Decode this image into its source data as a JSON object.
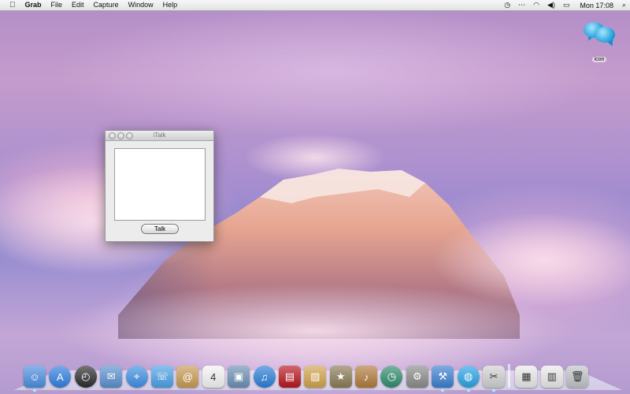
{
  "menubar": {
    "apple_icon": "apple-icon",
    "app_name": "Grab",
    "menus": [
      "File",
      "Edit",
      "Capture",
      "Window",
      "Help"
    ],
    "status_icons": [
      "time-machine-icon",
      "bluetooth-icon",
      "wifi-icon",
      "volume-icon",
      "battery-icon"
    ],
    "clock": "Mon 17:08",
    "spotlight_icon": "spotlight-icon"
  },
  "desktop": {
    "icon_label": "icon"
  },
  "window": {
    "title": "iTalk",
    "button_label": "Talk",
    "text_value": ""
  },
  "dock": {
    "items": [
      {
        "name": "finder-icon",
        "color": "#4a8ee0",
        "glyph": "☺",
        "running": true
      },
      {
        "name": "app-store-icon",
        "color": "#2f7fe0",
        "glyph": "A",
        "running": false
      },
      {
        "name": "dashboard-icon",
        "color": "#2b2b2b",
        "glyph": "◴",
        "running": false
      },
      {
        "name": "mail-stamp-icon",
        "color": "#5a8fcf",
        "glyph": "✉",
        "running": false
      },
      {
        "name": "safari-icon",
        "color": "#3d8fe4",
        "glyph": "⌖",
        "running": false
      },
      {
        "name": "facetime-icon",
        "color": "#4aa0e8",
        "glyph": "☏",
        "running": false
      },
      {
        "name": "address-book-icon",
        "color": "#c79a52",
        "glyph": "@",
        "running": false
      },
      {
        "name": "ical-icon",
        "color": "#f4f4f4",
        "glyph": "4",
        "running": false
      },
      {
        "name": "preview-icon",
        "color": "#6b8fb5",
        "glyph": "▣",
        "running": false
      },
      {
        "name": "itunes-icon",
        "color": "#2a7ed8",
        "glyph": "♫",
        "running": false
      },
      {
        "name": "photo-booth-icon",
        "color": "#b8161e",
        "glyph": "▤",
        "running": false
      },
      {
        "name": "iphoto-icon",
        "color": "#d1a24a",
        "glyph": "▨",
        "running": false
      },
      {
        "name": "imovie-icon",
        "color": "#8a7a55",
        "glyph": "★",
        "running": false
      },
      {
        "name": "garageband-icon",
        "color": "#b07a3a",
        "glyph": "♪",
        "running": false
      },
      {
        "name": "time-machine-icon",
        "color": "#2f8c6d",
        "glyph": "◷",
        "running": false
      },
      {
        "name": "system-preferences-icon",
        "color": "#8a8a8a",
        "glyph": "⚙",
        "running": false
      },
      {
        "name": "xcode-icon",
        "color": "#3a7fd0",
        "glyph": "⚒",
        "running": true
      },
      {
        "name": "italk-icon",
        "color": "#27a3e6",
        "glyph": "◍",
        "running": true
      },
      {
        "name": "grab-icon",
        "color": "#d0d0d0",
        "glyph": "✂",
        "running": true
      },
      {
        "name": "downloads-stack-icon",
        "color": "#e9e9e9",
        "glyph": "▦",
        "running": false
      },
      {
        "name": "documents-stack-icon",
        "color": "#eaeaea",
        "glyph": "▥",
        "running": false
      },
      {
        "name": "trash-icon",
        "color": "#bfc4c8",
        "glyph": "🗑",
        "running": false
      }
    ]
  }
}
